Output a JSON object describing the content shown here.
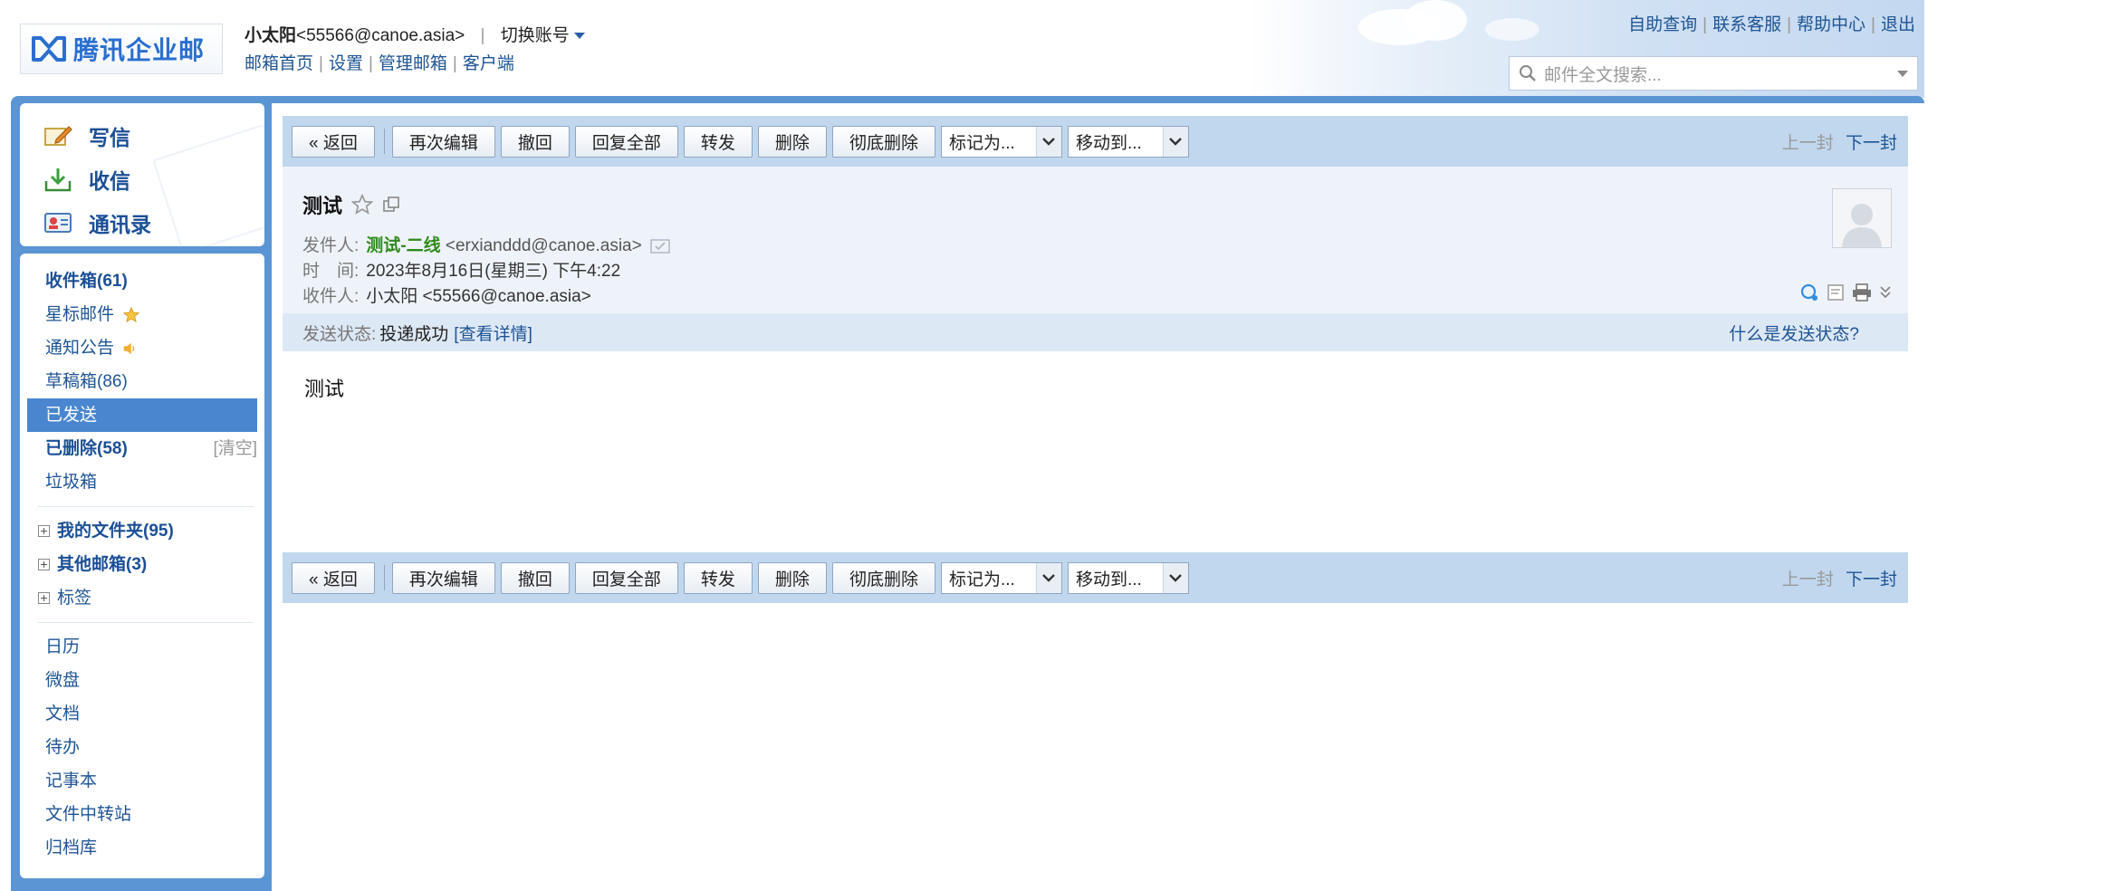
{
  "header": {
    "logo_text": "腾讯企业邮",
    "user_name": "小太阳",
    "user_email": "<55566@canoe.asia>",
    "switch_account": "切换账号",
    "links": [
      "邮箱首页",
      "设置",
      "管理邮箱",
      "客户端"
    ],
    "top_links": [
      "自助查询",
      "联系客服",
      "帮助中心",
      "退出"
    ],
    "search_placeholder": "邮件全文搜索..."
  },
  "sidebar": {
    "actions": [
      {
        "label": "写信",
        "icon": "compose-icon"
      },
      {
        "label": "收信",
        "icon": "inbox-download-icon"
      },
      {
        "label": "通讯录",
        "icon": "contacts-icon"
      }
    ],
    "folders": {
      "inbox": "收件箱(61)",
      "starred": "星标邮件",
      "notice": "通知公告",
      "drafts": "草稿箱(86)",
      "sent": "已发送",
      "deleted": "已删除(58)",
      "clear": "[清空]",
      "spam": "垃圾箱",
      "my_folders": "我的文件夹(95)",
      "other_mailboxes": "其他邮箱(3)",
      "tags": "标签",
      "apps": [
        "日历",
        "微盘",
        "文档",
        "待办",
        "记事本",
        "文件中转站",
        "归档库"
      ]
    }
  },
  "toolbar": {
    "back": "« 返回",
    "reedit": "再次编辑",
    "recall": "撤回",
    "reply_all": "回复全部",
    "forward": "转发",
    "delete": "删除",
    "delete_forever": "彻底删除",
    "mark_as": "标记为...",
    "move_to": "移动到...",
    "prev": "上一封",
    "next": "下一封"
  },
  "mail": {
    "subject": "测试",
    "from_label": "发件人:",
    "from_name": "测试-二线",
    "from_addr": "<erxianddd@canoe.asia>",
    "time_label": "时　间:",
    "time_value": "2023年8月16日(星期三) 下午4:22",
    "to_label": "收件人:",
    "to_value": "小太阳 <55566@canoe.asia>",
    "status_label": "发送状态:",
    "status_value": "投递成功",
    "status_detail": "[查看详情]",
    "status_help": "什么是发送状态?",
    "body": "测试"
  },
  "colors": {
    "frame": "#5b95d4",
    "toolbar": "#c0d7ee",
    "link": "#1e5494",
    "sender": "#2e8b1a",
    "active_folder": "#4a86cf"
  }
}
